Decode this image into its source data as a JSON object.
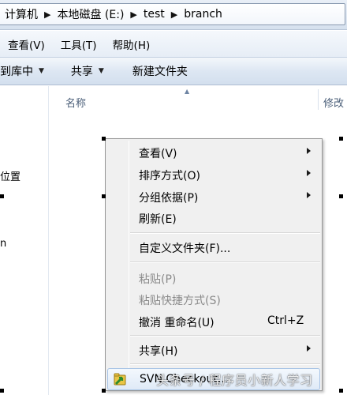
{
  "address": {
    "crumbs": [
      "计算机",
      "本地磁盘 (E:)",
      "test",
      "branch"
    ]
  },
  "menubar": {
    "items": [
      "查看(V)",
      "工具(T)",
      "帮助(H)"
    ]
  },
  "commandbar": {
    "include_library": "到库中",
    "share": "共享",
    "new_folder": "新建文件夹"
  },
  "navpane": {
    "location_label": "位置",
    "partial_label": "n"
  },
  "content": {
    "col_name": "名称",
    "col_modified": "修改"
  },
  "context_menu": {
    "view": "查看(V)",
    "sort_by": "排序方式(O)",
    "group_by": "分组依据(P)",
    "refresh": "刷新(E)",
    "customize_folder": "自定义文件夹(F)...",
    "paste": "粘贴(P)",
    "paste_shortcut": "粘贴快捷方式(S)",
    "undo_rename": "撤消 重命名(U)",
    "undo_shortcut": "Ctrl+Z",
    "share": "共享(H)",
    "svn_checkout": "SVN Checkout..."
  },
  "watermark": "头条号 / 程序员小新人学习",
  "colors": {
    "highlight_border": "#a8c4e6",
    "menu_bg": "#f0f0f0",
    "disabled_text": "#8a8a8a"
  }
}
